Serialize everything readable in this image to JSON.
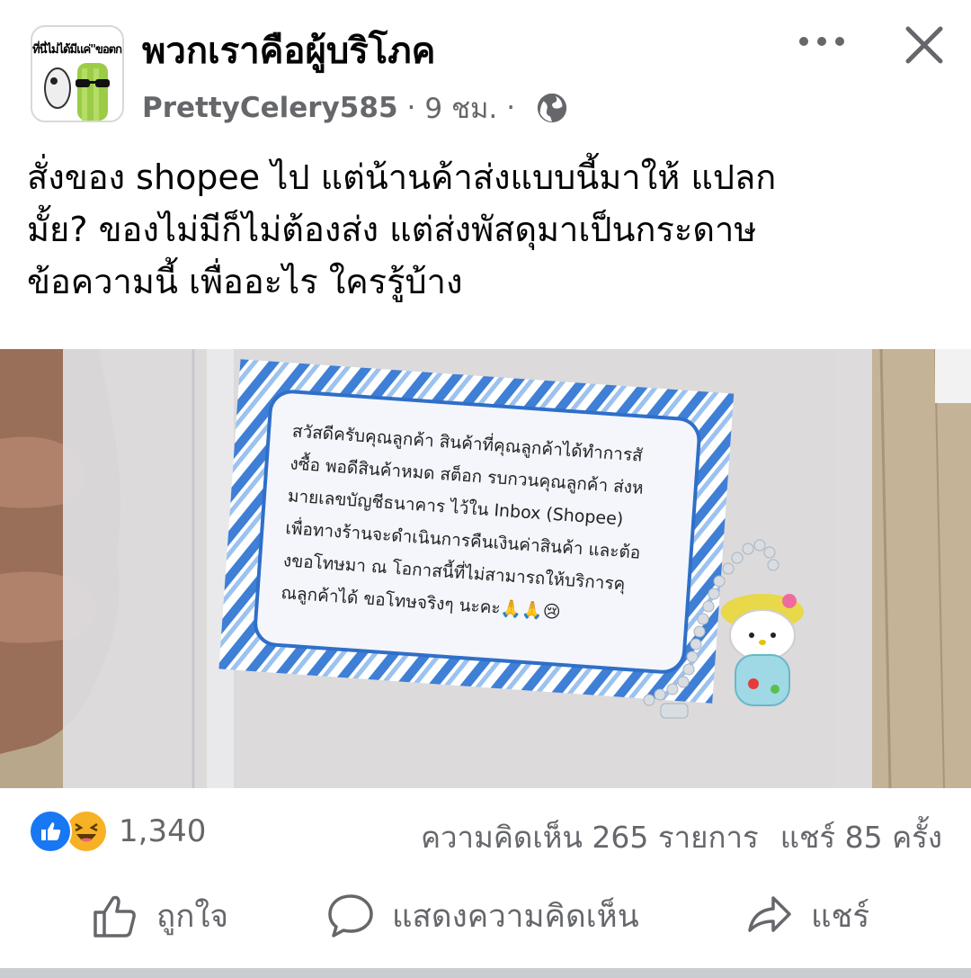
{
  "group": {
    "name": "พวกเราคือผู้บริโภค",
    "avatar_caption": "ที่นี่ไม่ได้มีแค่\"ขอตก\""
  },
  "post": {
    "author": "PrettyCelery585",
    "time": "9 ชม.",
    "dot": "·",
    "text_lines": [
      "สั่งของ shopee ไป แต่น้านค้าส่งแบบนี้มาให้ แปลก",
      "มั้ย? ของไม่มีก็ไม่ต้องส่ง แต่ส่งพัสดุมาเป็นกระดาษ",
      "ข้อความนี้ เพื่ออะไร ใครรู้บ้าง"
    ]
  },
  "photo_card": {
    "lines": [
      "สวัสดีครับคุณลูกค้า สินค้าที่คุณลูกค้าได้ทำการสั",
      "งซื้อ พอดีสินค้าหมด สต็อก รบกวนคุณลูกค้า ส่งห",
      "มายเลขบัญชีธนาคาร ไว้ใน Inbox (Shopee)",
      "เพื่อทางร้านจะดำเนินการคืนเงินค่าสินค้า และต้อ",
      "งขอโทษมา ณ โอกาสนี้ที่ไม่สามารถให้บริการคุ",
      "ณลูกค้าได้ ขอโทษจริงๆ นะคะ🙏🙏😢"
    ]
  },
  "stats": {
    "reaction_count": "1,340",
    "comments": "ความคิดเห็น 265 รายการ",
    "shares": "แชร์ 85 ครั้ง"
  },
  "actions": {
    "like": "ถูกใจ",
    "comment": "แสดงความคิดเห็น",
    "share": "แชร์"
  },
  "icons": {
    "globe": "globe-icon",
    "more": "more-horizontal-icon",
    "close": "close-icon",
    "like": "like-thumb-icon",
    "comment": "comment-bubble-icon",
    "share": "share-arrow-icon"
  },
  "colors": {
    "accent": "#1877f2",
    "secondary_text": "#65676b",
    "haha": "#f7b125"
  }
}
